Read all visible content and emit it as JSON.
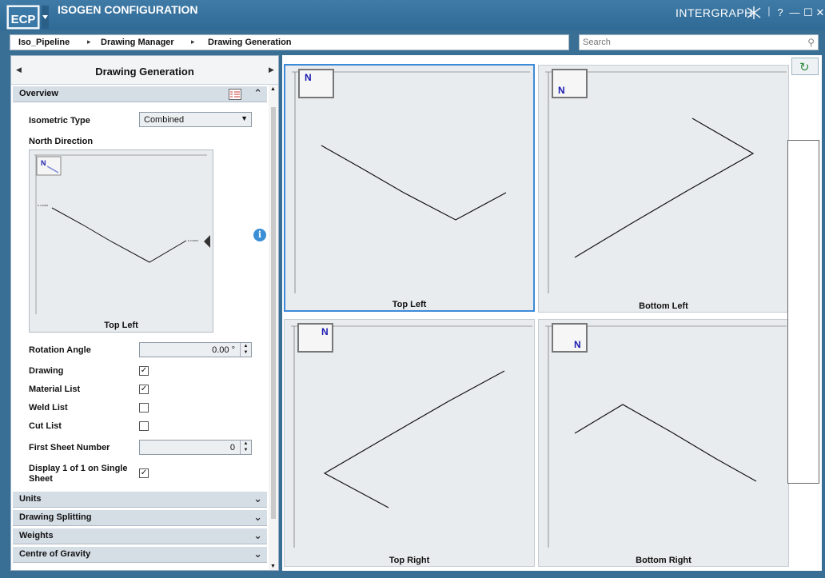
{
  "app": {
    "badge": "ECP",
    "title": "ISOGEN CONFIGURATION",
    "brand": "INTERGRAPH",
    "help": "?"
  },
  "breadcrumb": [
    "Iso_Pipeline",
    "Drawing Manager",
    "Drawing Generation"
  ],
  "search": {
    "placeholder": "Search"
  },
  "panel": {
    "title": "Drawing Generation",
    "overview": "Overview",
    "isometric_type_label": "Isometric Type",
    "isometric_type_value": "Combined",
    "north_direction_label": "North Direction",
    "north_preview_caption": "Top Left",
    "rotation_angle_label": "Rotation Angle",
    "rotation_angle_value": "0.00 °",
    "drawing_label": "Drawing",
    "drawing_checked": true,
    "material_list_label": "Material List",
    "material_list_checked": true,
    "weld_list_label": "Weld List",
    "weld_list_checked": false,
    "cut_list_label": "Cut List",
    "cut_list_checked": false,
    "first_sheet_label": "First Sheet Number",
    "first_sheet_value": "0",
    "display_1of1_label_line1": "Display 1 of 1 on Single",
    "display_1of1_label_line2": "Sheet",
    "display_1of1_checked": true,
    "sections": [
      "Units",
      "Drawing Splitting",
      "Weights",
      "Centre of Gravity"
    ]
  },
  "previews": [
    {
      "caption": "Top Left",
      "north": "N",
      "selected": true
    },
    {
      "caption": "Bottom Left",
      "north": "N",
      "selected": false
    },
    {
      "caption": "Top Right",
      "north": "N",
      "selected": false
    },
    {
      "caption": "Bottom Right",
      "north": "N",
      "selected": false
    }
  ]
}
